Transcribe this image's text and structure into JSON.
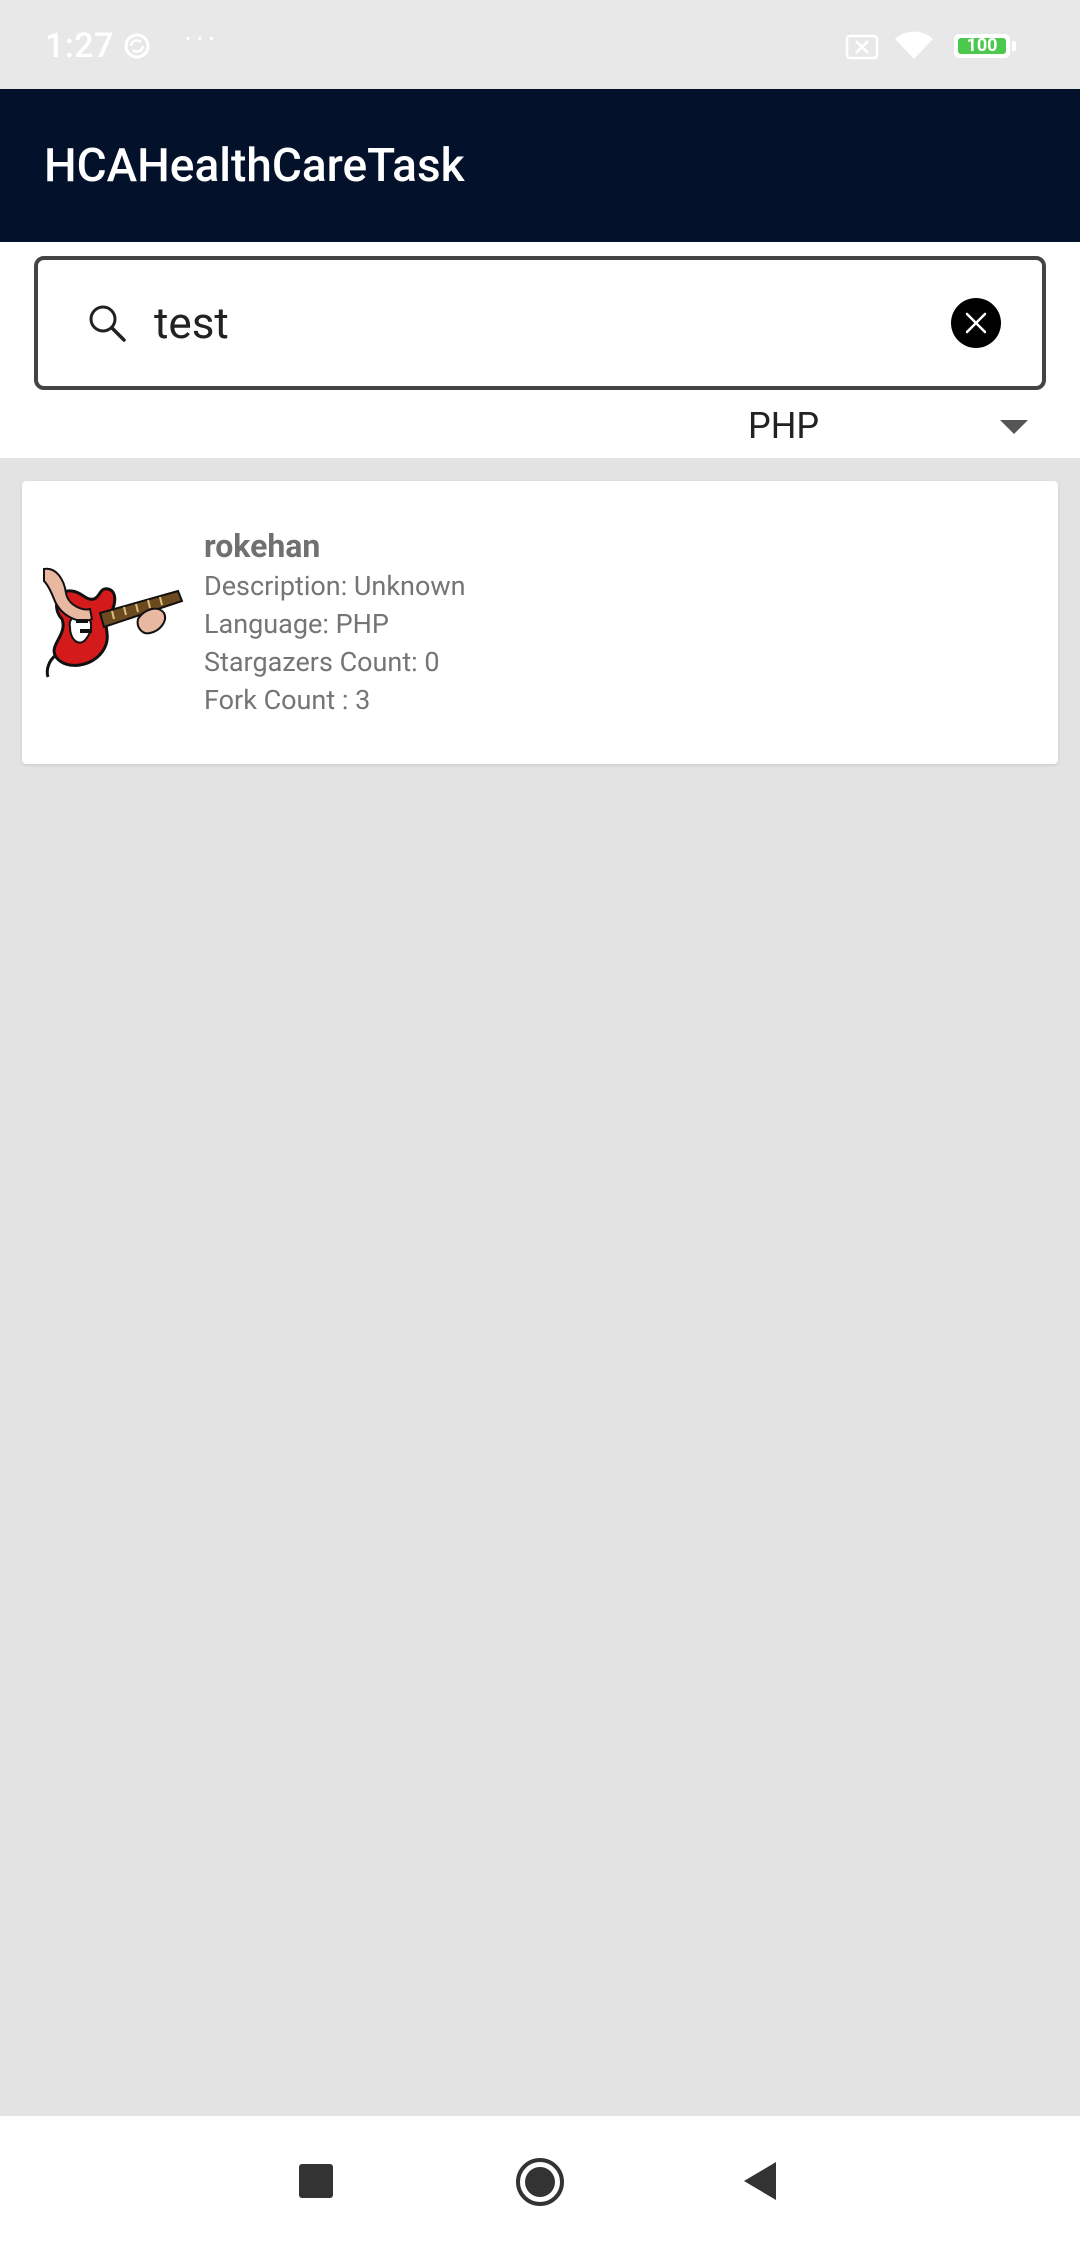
{
  "status_bar": {
    "time": "1:27",
    "dots": "···",
    "battery_level": "100",
    "icons": [
      "sync-icon",
      "no-sim-icon",
      "wifi-icon",
      "battery-icon"
    ]
  },
  "app_bar": {
    "title": "HCAHealthCareTask"
  },
  "search": {
    "value": "test",
    "icon": "search-icon",
    "clear_icon": "close-icon"
  },
  "language_filter": {
    "selected": "PHP",
    "icon": "chevron-down-icon"
  },
  "results": [
    {
      "name": "rokehan",
      "description": "Description: Unknown",
      "language": "Language: PHP",
      "stargazers": "Stargazers Count: 0",
      "forks": "Fork Count : 3",
      "avatar": "guitar-player-avatar"
    }
  ],
  "nav_bar": {
    "icons": [
      "recents-icon",
      "home-icon",
      "back-icon"
    ]
  },
  "colors": {
    "app_bar": "#04112b",
    "background": "#e3e3e3",
    "battery_fill": "#4cc84c"
  }
}
